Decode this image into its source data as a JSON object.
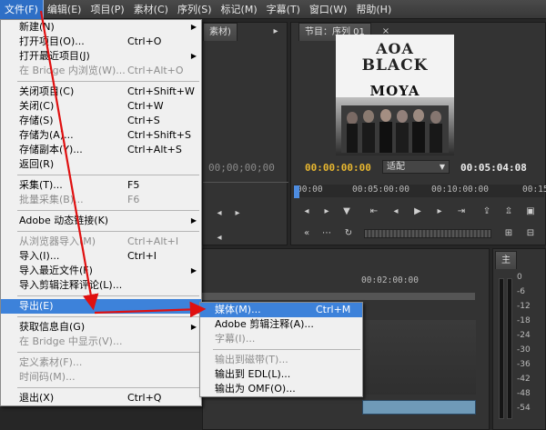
{
  "menubar": {
    "items": [
      {
        "label": "文件(F)",
        "active": true
      },
      {
        "label": "编辑(E)"
      },
      {
        "label": "项目(P)"
      },
      {
        "label": "素材(C)"
      },
      {
        "label": "序列(S)"
      },
      {
        "label": "标记(M)"
      },
      {
        "label": "字幕(T)"
      },
      {
        "label": "窗口(W)"
      },
      {
        "label": "帮助(H)"
      }
    ]
  },
  "source_panel": {
    "tab_label": "素材)",
    "timecode": "00;00;00;00"
  },
  "program_panel": {
    "tab_label": "节目：序列 01",
    "timecode_current": "00:00:00:00",
    "zoom_option": "适配",
    "timecode_duration": "00:05:04:08",
    "ruler_labels": [
      "00:00",
      "00:05:00:00",
      "00:10:00:00",
      "00:15"
    ],
    "album": {
      "line1": "AOA",
      "line2": "BLACK",
      "line3": "MOYA"
    }
  },
  "timeline_panel": {
    "ruler_label": "00:02:00:00"
  },
  "audio_panel": {
    "tab_label": "主",
    "db_labels": [
      "0",
      "-6",
      "-12",
      "-18",
      "-24",
      "-30",
      "-36",
      "-42",
      "-48",
      "-54"
    ]
  },
  "file_menu": {
    "items": [
      {
        "type": "item",
        "label": "新建(N)",
        "shortcut": "",
        "submenu": true,
        "disabled": false
      },
      {
        "type": "item",
        "label": "打开项目(O)...",
        "shortcut": "Ctrl+O",
        "submenu": false,
        "disabled": false
      },
      {
        "type": "item",
        "label": "打开最近项目(J)",
        "shortcut": "",
        "submenu": true,
        "disabled": false
      },
      {
        "type": "item",
        "label": "在 Bridge 内浏览(W)...",
        "shortcut": "Ctrl+Alt+O",
        "submenu": false,
        "disabled": true
      },
      {
        "type": "sep"
      },
      {
        "type": "item",
        "label": "关闭项目(C)",
        "shortcut": "Ctrl+Shift+W",
        "submenu": false,
        "disabled": false
      },
      {
        "type": "item",
        "label": "关闭(C)",
        "shortcut": "Ctrl+W",
        "submenu": false,
        "disabled": false
      },
      {
        "type": "item",
        "label": "存储(S)",
        "shortcut": "Ctrl+S",
        "submenu": false,
        "disabled": false
      },
      {
        "type": "item",
        "label": "存储为(A)...",
        "shortcut": "Ctrl+Shift+S",
        "submenu": false,
        "disabled": false
      },
      {
        "type": "item",
        "label": "存储副本(Y)...",
        "shortcut": "Ctrl+Alt+S",
        "submenu": false,
        "disabled": false
      },
      {
        "type": "item",
        "label": "返回(R)",
        "shortcut": "",
        "submenu": false,
        "disabled": false
      },
      {
        "type": "sep"
      },
      {
        "type": "item",
        "label": "采集(T)...",
        "shortcut": "F5",
        "submenu": false,
        "disabled": false
      },
      {
        "type": "item",
        "label": "批量采集(B)...",
        "shortcut": "F6",
        "submenu": false,
        "disabled": true
      },
      {
        "type": "sep"
      },
      {
        "type": "item",
        "label": "Adobe 动态链接(K)",
        "shortcut": "",
        "submenu": true,
        "disabled": false
      },
      {
        "type": "sep"
      },
      {
        "type": "item",
        "label": "从浏览器导入(M)",
        "shortcut": "Ctrl+Alt+I",
        "submenu": false,
        "disabled": true
      },
      {
        "type": "item",
        "label": "导入(I)...",
        "shortcut": "Ctrl+I",
        "submenu": false,
        "disabled": false
      },
      {
        "type": "item",
        "label": "导入最近文件(F)",
        "shortcut": "",
        "submenu": true,
        "disabled": false
      },
      {
        "type": "item",
        "label": "导入剪辑注释评论(L)...",
        "shortcut": "",
        "submenu": false,
        "disabled": false
      },
      {
        "type": "sep"
      },
      {
        "type": "item",
        "label": "导出(E)",
        "shortcut": "",
        "submenu": true,
        "disabled": false,
        "highlighted": true
      },
      {
        "type": "sep"
      },
      {
        "type": "item",
        "label": "获取信息自(G)",
        "shortcut": "",
        "submenu": true,
        "disabled": false
      },
      {
        "type": "item",
        "label": "在 Bridge 中显示(V)...",
        "shortcut": "",
        "submenu": false,
        "disabled": true
      },
      {
        "type": "sep"
      },
      {
        "type": "item",
        "label": "定义素材(F)...",
        "shortcut": "",
        "submenu": false,
        "disabled": true
      },
      {
        "type": "item",
        "label": "时间码(M)...",
        "shortcut": "",
        "submenu": false,
        "disabled": true
      },
      {
        "type": "sep"
      },
      {
        "type": "item",
        "label": "退出(X)",
        "shortcut": "Ctrl+Q",
        "submenu": false,
        "disabled": false
      }
    ]
  },
  "export_submenu": {
    "items": [
      {
        "type": "item",
        "label": "媒体(M)...",
        "shortcut": "Ctrl+M",
        "disabled": false,
        "highlighted": true
      },
      {
        "type": "item",
        "label": "Adobe 剪辑注释(A)...",
        "shortcut": "",
        "disabled": false
      },
      {
        "type": "item",
        "label": "字幕(I)...",
        "shortcut": "",
        "disabled": true
      },
      {
        "type": "sep"
      },
      {
        "type": "item",
        "label": "输出到磁带(T)...",
        "shortcut": "",
        "disabled": true
      },
      {
        "type": "item",
        "label": "输出到 EDL(L)...",
        "shortcut": "",
        "disabled": false
      },
      {
        "type": "item",
        "label": "输出为 OMF(O)...",
        "shortcut": "",
        "disabled": false
      }
    ]
  },
  "colors": {
    "menubar_active": "#2e6fc6",
    "menu_highlight": "#3d82da",
    "arrow": "#e01010",
    "timecode_yellow": "#e8b730"
  }
}
